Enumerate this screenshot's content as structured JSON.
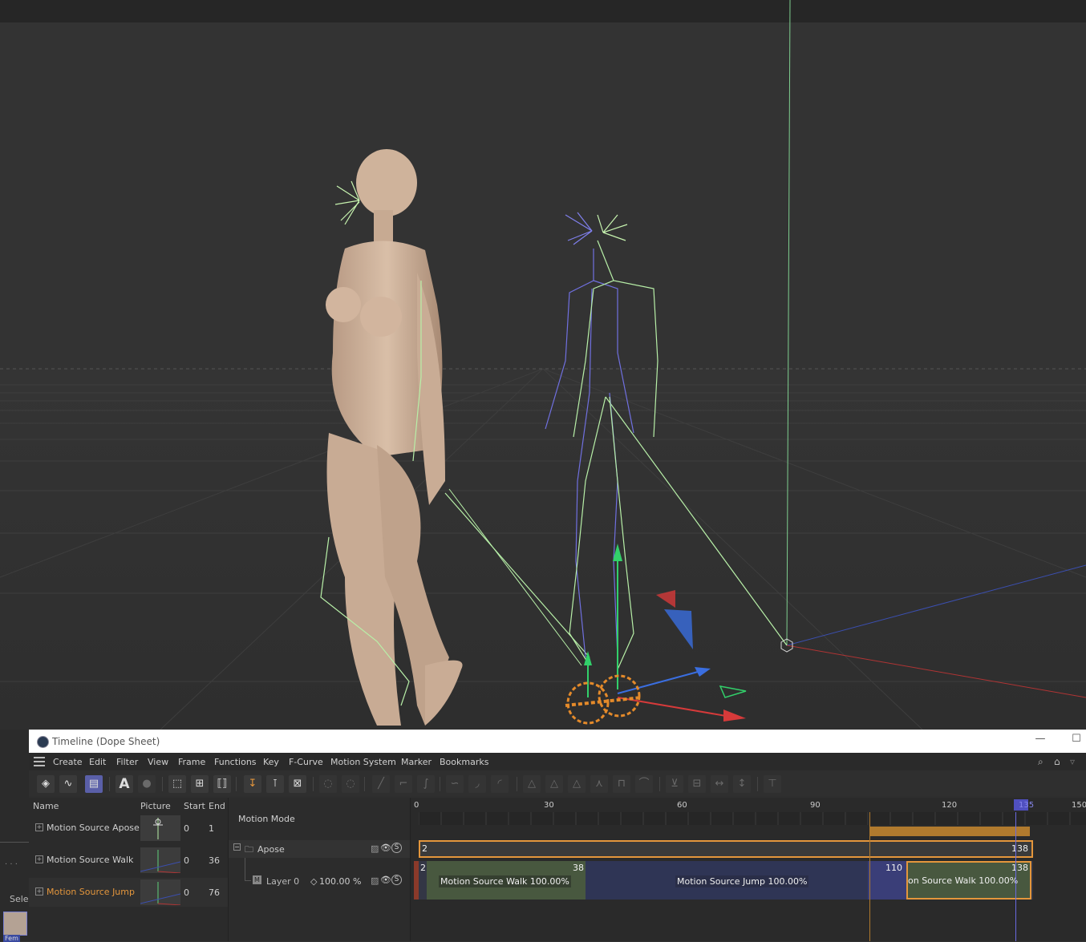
{
  "window": {
    "title": "Timeline (Dope Sheet)",
    "minimize_glyph": "—",
    "maximize_glyph": "☐"
  },
  "left_strip": {
    "tag": "Selec",
    "thumb_label": "Fem"
  },
  "menu": {
    "items": [
      "Create",
      "Edit",
      "View",
      "Filter",
      "Frame",
      "Functions",
      "Key",
      "F-Curve",
      "Motion System",
      "Marker",
      "Bookmarks"
    ]
  },
  "toolbar": {
    "icons": [
      "key-mode-icon",
      "fcurve-mode-icon",
      "motion-mode-icon",
      "text-icon",
      "sphere-icon",
      "frame-all-icon",
      "frame-selected-icon",
      "frame-preview-icon",
      "key-icon",
      "add-key-icon",
      "delete-key-icon",
      "zero-key-icon",
      "zero-angle-icon",
      "linear-icon",
      "step-icon",
      "spline-icon",
      "ease-icon",
      "ease-in-icon",
      "ease-out-icon",
      "auto-tangent-icon",
      "lock-tangent-icon",
      "lock-angle-icon",
      "break-tangent-icon",
      "clamp-icon",
      "overshoot-icon",
      "weight-icon",
      "unlock-icon",
      "lock-time-icon",
      "lock-value-icon",
      "paint-icon"
    ],
    "text_icon_glyph": "A"
  },
  "list": {
    "headers": {
      "name": "Name",
      "picture": "Picture",
      "start": "Start",
      "end": "End"
    },
    "rows": [
      {
        "name": "Motion Source Apose",
        "start": "0",
        "end": "1",
        "highlight": false
      },
      {
        "name": "Motion Source Walk",
        "start": "0",
        "end": "36",
        "highlight": false
      },
      {
        "name": "Motion Source Jump",
        "start": "0",
        "end": "76",
        "highlight": true
      }
    ]
  },
  "motion": {
    "mode_label": "Motion Mode",
    "group_name": "Apose",
    "layer_name": "Layer 0",
    "layer_value": "100.00 %",
    "solo_glyph": "S"
  },
  "ruler": {
    "ticks": [
      "0",
      "30",
      "60",
      "90",
      "120",
      "135",
      "150"
    ],
    "current_frame": "135"
  },
  "tracks": {
    "apose_start": "2",
    "apose_end": "138",
    "layer_start": "2",
    "clip1_label": "Motion Source Walk  100.00%",
    "clip1_end": "38",
    "clip2_label": "Motion Source Jump  100.00%",
    "clip3_start": "110",
    "clip3_label": "on Source Walk  100.00%",
    "layer_end": "138"
  },
  "colors": {
    "accent_orange": "#e4963c",
    "active_blue": "#5a5fa8",
    "walk_clip": "#4a5a48",
    "jump_clip": "#2f3555",
    "skeleton_green": "#b8f0a8",
    "skeleton_blue": "#6f6fe0"
  }
}
